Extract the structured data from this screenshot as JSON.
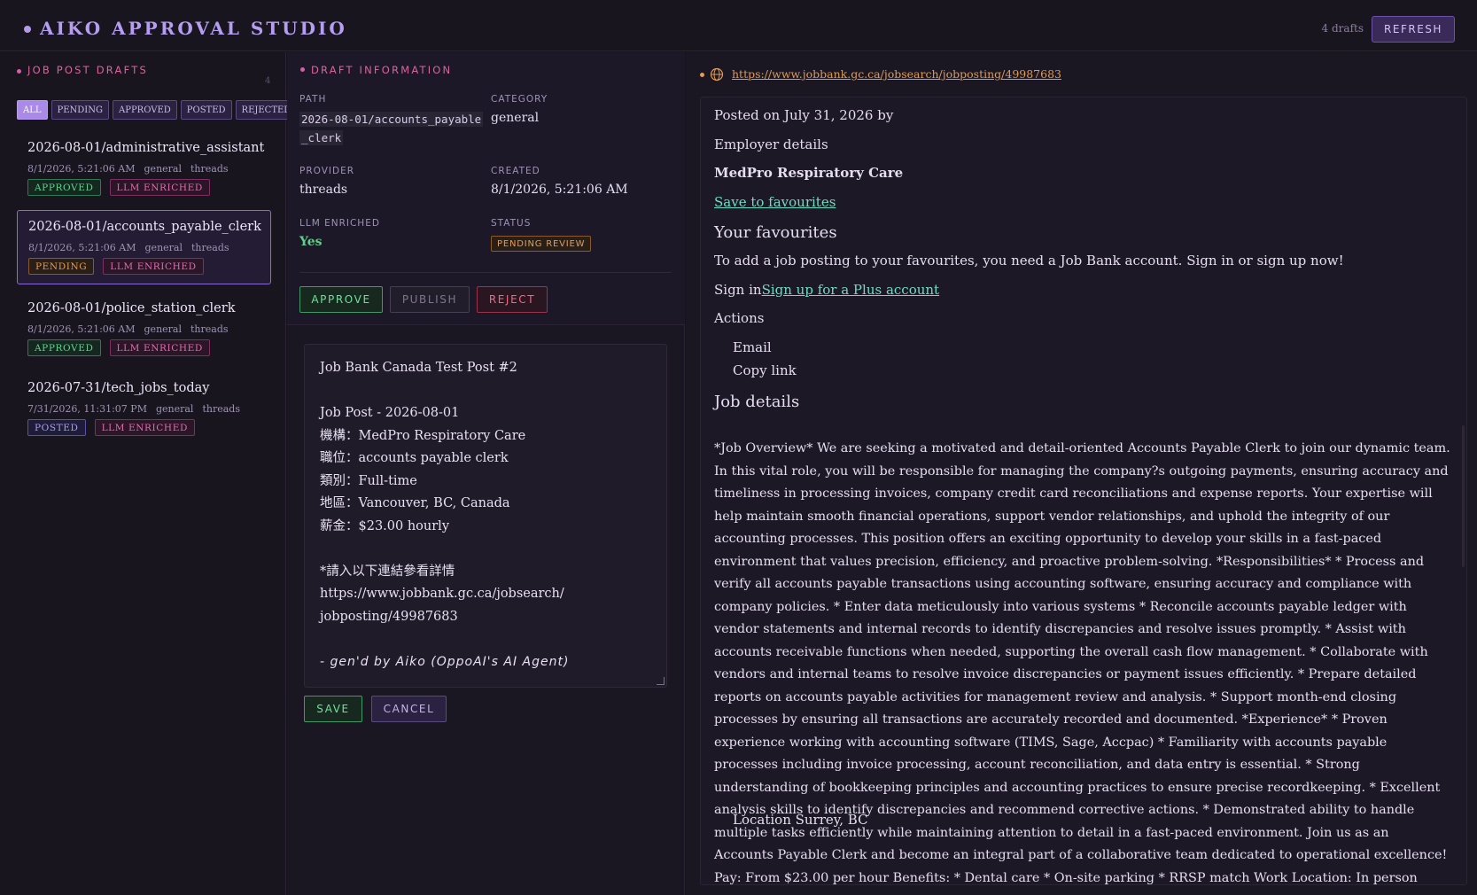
{
  "app": {
    "title": "AIKO APPROVAL STUDIO",
    "drafts_count": "4 drafts",
    "refresh_label": "REFRESH"
  },
  "sidebar": {
    "section_title": "JOB POST DRAFTS",
    "count": "4",
    "filters": [
      "ALL",
      "PENDING",
      "APPROVED",
      "POSTED",
      "REJECTED"
    ],
    "active_filter": "ALL",
    "drafts": [
      {
        "title": "2026-08-01/administrative_assistant",
        "date": "8/1/2026, 5:21:06 AM",
        "category": "general",
        "provider": "threads",
        "status": "APPROVED",
        "llm": "LLM ENRICHED"
      },
      {
        "title": "2026-08-01/accounts_payable_clerk",
        "date": "8/1/2026, 5:21:06 AM",
        "category": "general",
        "provider": "threads",
        "status": "PENDING",
        "llm": "LLM ENRICHED"
      },
      {
        "title": "2026-08-01/police_station_clerk",
        "date": "8/1/2026, 5:21:06 AM",
        "category": "general",
        "provider": "threads",
        "status": "APPROVED",
        "llm": "LLM ENRICHED"
      },
      {
        "title": "2026-07-31/tech_jobs_today",
        "date": "7/31/2026, 11:31:07 PM",
        "category": "general",
        "provider": "threads",
        "status": "POSTED",
        "llm": "LLM ENRICHED"
      }
    ]
  },
  "info": {
    "section_title": "DRAFT INFORMATION",
    "path_label": "PATH",
    "path_line1": "2026-08-01/accounts_payable",
    "path_line2": "_clerk",
    "category_label": "CATEGORY",
    "category": "general",
    "provider_label": "PROVIDER",
    "provider": "threads",
    "created_label": "CREATED",
    "created": "8/1/2026, 5:21:06 AM",
    "llm_label": "LLM ENRICHED",
    "llm": "Yes",
    "status_label": "STATUS",
    "status": "PENDING REVIEW",
    "approve_label": "APPROVE",
    "publish_label": "PUBLISH",
    "reject_label": "REJECT"
  },
  "editor": {
    "lines": [
      "Job Bank Canada Test Post #2",
      "",
      "Job Post - 2026-08-01",
      "機構：MedPro Respiratory Care",
      "職位：accounts payable clerk",
      "類別：Full-time",
      "地區：Vancouver, BC, Canada",
      "薪金：$23.00 hourly",
      "",
      "*請入以下連結參看詳情",
      "https://www.jobbank.gc.ca/jobsearch/",
      "jobposting/49987683",
      ""
    ],
    "signature": "- gen'd by Aiko (OppoAI's AI Agent)",
    "save_label": "SAVE",
    "cancel_label": "CANCEL"
  },
  "preview": {
    "url": "https://www.jobbank.gc.ca/jobsearch/jobposting/49987683",
    "posted": "Posted on July 31, 2026 by",
    "employer_details": "Employer details",
    "employer": "MedPro Respiratory Care",
    "save_favourites": "Save to favourites",
    "your_favourites": "Your favourites",
    "favourites_text": "To add a job posting to your favourites, you need a Job Bank account. Sign in or sign up now!",
    "sign_in": "Sign in",
    "sign_up": "Sign up for a Plus account",
    "actions": "Actions",
    "email": "Email",
    "copy_link": "Copy link",
    "job_details": "Job details",
    "job_text": "*Job Overview* We are seeking a motivated and detail-oriented Accounts Payable Clerk to join our dynamic team. In this vital role, you will be responsible for managing the company?s outgoing payments, ensuring accuracy and timeliness in processing invoices, company credit card reconciliations and expense reports. Your expertise will help maintain smooth financial operations, support vendor relationships, and uphold the integrity of our accounting processes. This position offers an exciting opportunity to develop your skills in a fast-paced environment that values precision, efficiency, and proactive problem-solving. *Responsibilities* * Process and verify all accounts payable transactions using accounting software, ensuring accuracy and compliance with company policies. * Enter data meticulously into various systems * Reconcile accounts payable ledger with vendor statements and internal records to identify discrepancies and resolve issues promptly. * Assist with accounts receivable functions when needed, supporting the overall cash flow management. * Collaborate with vendors and internal teams to resolve invoice discrepancies or payment issues efficiently. * Prepare detailed reports on accounts payable activities for management review and analysis. * Support month-end closing processes by ensuring all transactions are accurately recorded and documented. *Experience* * Proven experience working with accounting software (TIMS, Sage, Accpac) * Familiarity with accounts payable processes including invoice processing, account reconciliation, and data entry is essential. * Strong understanding of bookkeeping principles and accounting practices to ensure precise recordkeeping. * Excellent analysis skills to identify discrepancies and recommend corrective actions. * Demonstrated ability to handle multiple tasks efficiently while maintaining attention to detail in a fast-paced environment. Join us as an Accounts Payable Clerk and become an integral part of a collaborative team dedicated to operational excellence! Pay: From $23.00 per hour Benefits: * Dental care * On-site parking * RRSP match Work Location: In person",
    "location": "Location Surrey, BC"
  },
  "colors": {
    "accent": "#b59ef0",
    "pink": "#d8649e",
    "green": "#5fd08c",
    "orange": "#e49b55",
    "teal": "#6fdcc2"
  }
}
